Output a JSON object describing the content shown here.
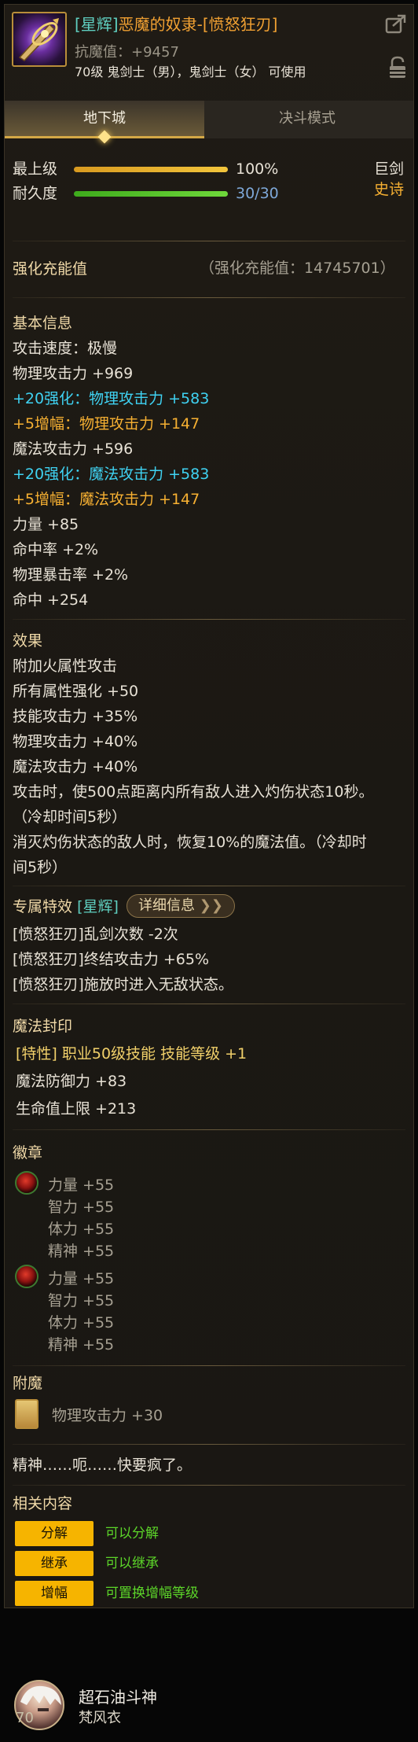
{
  "item": {
    "rarity_tag": "[星辉]",
    "name": "恶魔的奴隶-[愤怒狂刃]",
    "resistance": "抗魔值：+9457",
    "job": "70级 鬼剑士（男），鬼剑士（女） 可使用",
    "icon": "demon-slave-weapon-icon",
    "colors": {
      "name": "#f0a032",
      "rarity": "#5fcfc0",
      "accent": "#f6b400"
    }
  },
  "tabs": [
    {
      "label": "地下城",
      "active": true
    },
    {
      "label": "决斗模式",
      "active": false
    }
  ],
  "stats": {
    "top_label": "最上级",
    "top_value": "100%",
    "top_fraction": 1.0,
    "durability_label": "耐久度",
    "durability_value": "30/30",
    "durability_fraction": 1.0,
    "type": "巨剑",
    "grade": "史诗"
  },
  "charge": {
    "label": "强化充能值",
    "value": "（强化充能值：14745701）"
  },
  "basic": {
    "heading": "基本信息",
    "lines": [
      {
        "text": "攻击速度：极慢",
        "color": "white"
      },
      {
        "text": "物理攻击力 +969",
        "color": "white"
      },
      {
        "text": "+20强化：物理攻击力 +583",
        "color": "cyan"
      },
      {
        "text": " +5增幅：物理攻击力 +147",
        "color": "gold"
      },
      {
        "text": "魔法攻击力 +596",
        "color": "white"
      },
      {
        "text": "+20强化：魔法攻击力 +583",
        "color": "cyan"
      },
      {
        "text": " +5增幅：魔法攻击力 +147",
        "color": "gold"
      },
      {
        "text": "力量 +85",
        "color": "white"
      },
      {
        "text": "命中率 +2%",
        "color": "white"
      },
      {
        "text": "物理暴击率 +2%",
        "color": "white"
      },
      {
        "text": "命中 +254",
        "color": "white"
      }
    ]
  },
  "effects": {
    "heading": "效果",
    "lines": [
      "附加火属性攻击",
      "所有属性强化 +50",
      "技能攻击力 +35%",
      "物理攻击力 +40%",
      "魔法攻击力 +40%",
      "攻击时，使500点距离内所有敌人进入灼伤状态10秒。",
      "（冷却时间5秒）",
      "消灭灼伤状态的敌人时，恢复10%的魔法值。（冷却时",
      "间5秒）"
    ]
  },
  "special": {
    "heading": "专属特效",
    "tag": "[星辉]",
    "detail_button": "详细信息",
    "lines": [
      "[愤怒狂刃]乱剑次数 -2次",
      "[愤怒狂刃]终结攻击力 +65%",
      "[愤怒狂刃]施放时进入无敌状态。"
    ]
  },
  "seal": {
    "heading": "魔法封印",
    "lines": [
      {
        "text": "[特性] 职业50级技能 技能等级 +1",
        "color": "yellow"
      },
      {
        "text": "魔法防御力 +83",
        "color": "white"
      },
      {
        "text": "生命值上限 +213",
        "color": "white"
      }
    ]
  },
  "emblems": {
    "heading": "徽章",
    "groups": [
      {
        "icon": "red-emblem-icon",
        "lines": [
          "力量 +55",
          "智力 +55",
          "体力 +55",
          "精神 +55"
        ]
      },
      {
        "icon": "red-emblem-icon",
        "lines": [
          "力量 +55",
          "智力 +55",
          "体力 +55",
          "精神 +55"
        ]
      }
    ]
  },
  "enchant": {
    "heading": "附魔",
    "icon": "enchant-card-icon",
    "text": "物理攻击力 +30"
  },
  "flavor": "精神……呃……快要疯了。",
  "related": {
    "heading": "相关内容",
    "actions": [
      {
        "button": "分解",
        "text": "可以分解"
      },
      {
        "button": "继承",
        "text": "可以继承"
      },
      {
        "button": "增幅",
        "text": "可置换增幅等级"
      }
    ]
  },
  "footer": {
    "level": "70",
    "name": "超石油斗神",
    "subtitle": "梵风衣"
  }
}
